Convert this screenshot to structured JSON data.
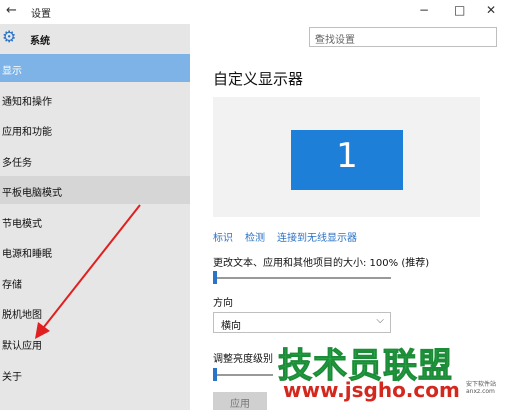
{
  "window": {
    "title": "设置",
    "back_glyph": "←",
    "min_glyph": "−",
    "max_glyph": "□",
    "close_glyph": "✕"
  },
  "sidebar": {
    "header": "系统",
    "items": [
      {
        "label": "显示",
        "state": "selected"
      },
      {
        "label": "通知和操作",
        "state": "normal"
      },
      {
        "label": "应用和功能",
        "state": "normal"
      },
      {
        "label": "多任务",
        "state": "normal"
      },
      {
        "label": "平板电脑模式",
        "state": "hover"
      },
      {
        "label": "节电模式",
        "state": "normal"
      },
      {
        "label": "电源和睡眠",
        "state": "normal"
      },
      {
        "label": "存储",
        "state": "normal"
      },
      {
        "label": "脱机地图",
        "state": "normal"
      },
      {
        "label": "默认应用",
        "state": "normal"
      },
      {
        "label": "关于",
        "state": "normal"
      }
    ]
  },
  "search": {
    "placeholder": "查找设置",
    "icon": "search-icon"
  },
  "main": {
    "title": "自定义显示器",
    "monitor_number": "1",
    "links": {
      "identify": "标识",
      "detect": "检测",
      "connect_wireless": "连接到无线显示器"
    },
    "scale_label": "更改文本、应用和其他项目的大小: 100% (推荐)",
    "scale_level": 0,
    "orientation_label": "方向",
    "orientation_value": "横向",
    "brightness_label": "调整亮度级别",
    "brightness_level": 0,
    "apply_label": "应用"
  },
  "watermark": {
    "brand": "技术员联盟",
    "url": "www.jsgho.com",
    "small": "安下软件站 anxz.com"
  },
  "colors": {
    "accent": "#2b73c6",
    "selected_bg": "#7db3e6",
    "sidebar_bg": "#e6e6e6",
    "monitor": "#1e7fd8",
    "arrow": "#e02020"
  }
}
